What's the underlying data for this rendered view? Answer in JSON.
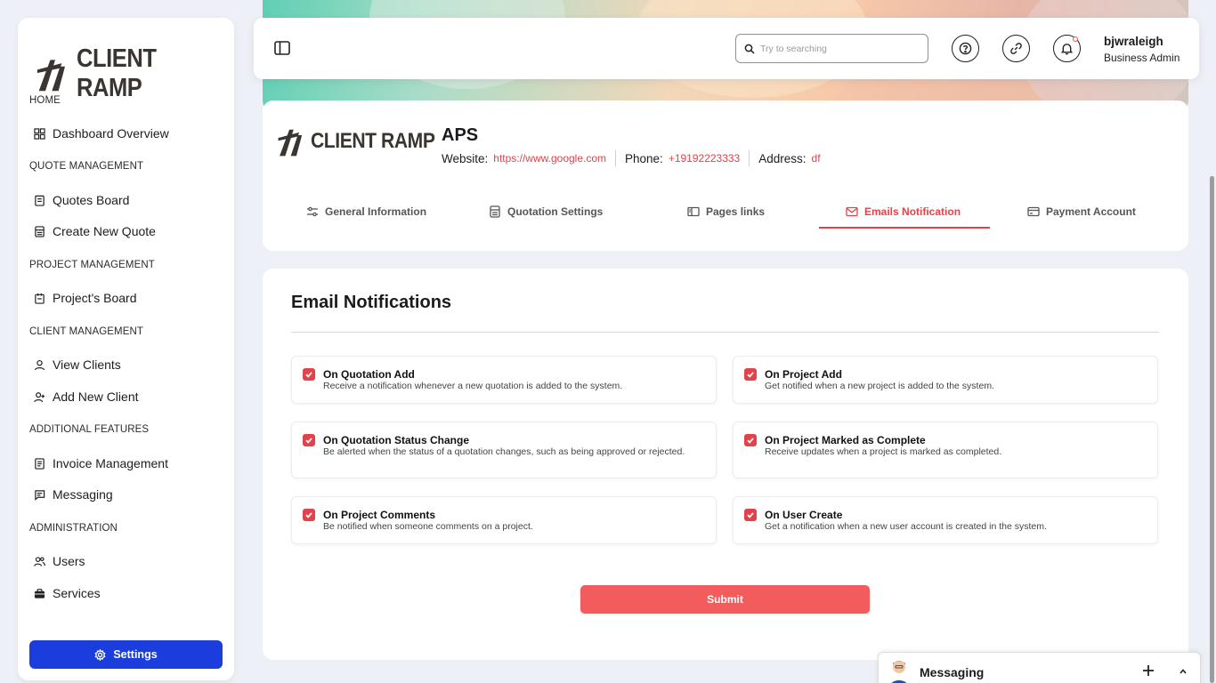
{
  "brand": {
    "logo_text": "CLIENT RAMP"
  },
  "sidebar": {
    "sections": [
      {
        "title": "HOME",
        "items": [
          {
            "label": "Dashboard Overview",
            "icon": "dashboard-grid-icon"
          }
        ]
      },
      {
        "title": "QUOTE MANAGEMENT",
        "items": [
          {
            "label": "Quotes Board",
            "icon": "clipboard-icon"
          },
          {
            "label": "Create New Quote",
            "icon": "calculator-icon"
          }
        ]
      },
      {
        "title": "PROJECT MANAGEMENT",
        "items": [
          {
            "label": "Project's Board",
            "icon": "project-board-icon"
          }
        ]
      },
      {
        "title": "CLIENT MANAGEMENT",
        "items": [
          {
            "label": "View Clients",
            "icon": "user-icon"
          },
          {
            "label": "Add New Client",
            "icon": "user-plus-icon"
          }
        ]
      },
      {
        "title": "ADDITIONAL FEATURES",
        "items": [
          {
            "label": "Invoice Management",
            "icon": "invoice-icon"
          },
          {
            "label": "Messaging",
            "icon": "message-icon"
          }
        ]
      },
      {
        "title": "ADMINISTRATION",
        "items": [
          {
            "label": "Users",
            "icon": "users-icon"
          },
          {
            "label": "Services",
            "icon": "briefcase-icon"
          }
        ]
      }
    ],
    "settings_label": "Settings"
  },
  "header": {
    "search_placeholder": "Try to searching",
    "user_name": "bjwraleigh",
    "user_role": "Business Admin"
  },
  "client": {
    "name": "APS",
    "website_label": "Website:",
    "website": "https://www.google.com",
    "phone_label": "Phone:",
    "phone": "+19192223333",
    "address_label": "Address:",
    "address": "df"
  },
  "tabs": [
    {
      "label": "General Information",
      "icon": "sliders-icon",
      "active": false
    },
    {
      "label": "Quotation Settings",
      "icon": "calculator-icon",
      "active": false
    },
    {
      "label": "Pages links",
      "icon": "pages-icon",
      "active": false
    },
    {
      "label": "Emails Notification",
      "icon": "mail-icon",
      "active": true
    },
    {
      "label": "Payment Account",
      "icon": "credit-card-icon",
      "active": false
    }
  ],
  "email_notifications": {
    "title": "Email Notifications",
    "options": [
      {
        "title": "On Quotation Add",
        "description": "Receive a notification whenever a new quotation is added to the system.",
        "checked": true
      },
      {
        "title": "On Project Add",
        "description": "Get notified when a new project is added to the system.",
        "checked": true
      },
      {
        "title": "On Quotation Status Change",
        "description": "Be alerted when the status of a quotation changes, such as being approved or rejected.",
        "checked": true
      },
      {
        "title": "On Project Marked as Complete",
        "description": "Receive updates when a project is marked as completed.",
        "checked": true
      },
      {
        "title": "On Project Comments",
        "description": "Be notified when someone comments on a project.",
        "checked": true
      },
      {
        "title": "On User Create",
        "description": "Get a notification when a new user account is created in the system.",
        "checked": true
      }
    ],
    "submit_label": "Submit"
  },
  "messaging_widget": {
    "label": "Messaging"
  },
  "colors": {
    "accent": "#e2434a",
    "primary": "#1c3ddd",
    "submit": "#f25c5c"
  }
}
